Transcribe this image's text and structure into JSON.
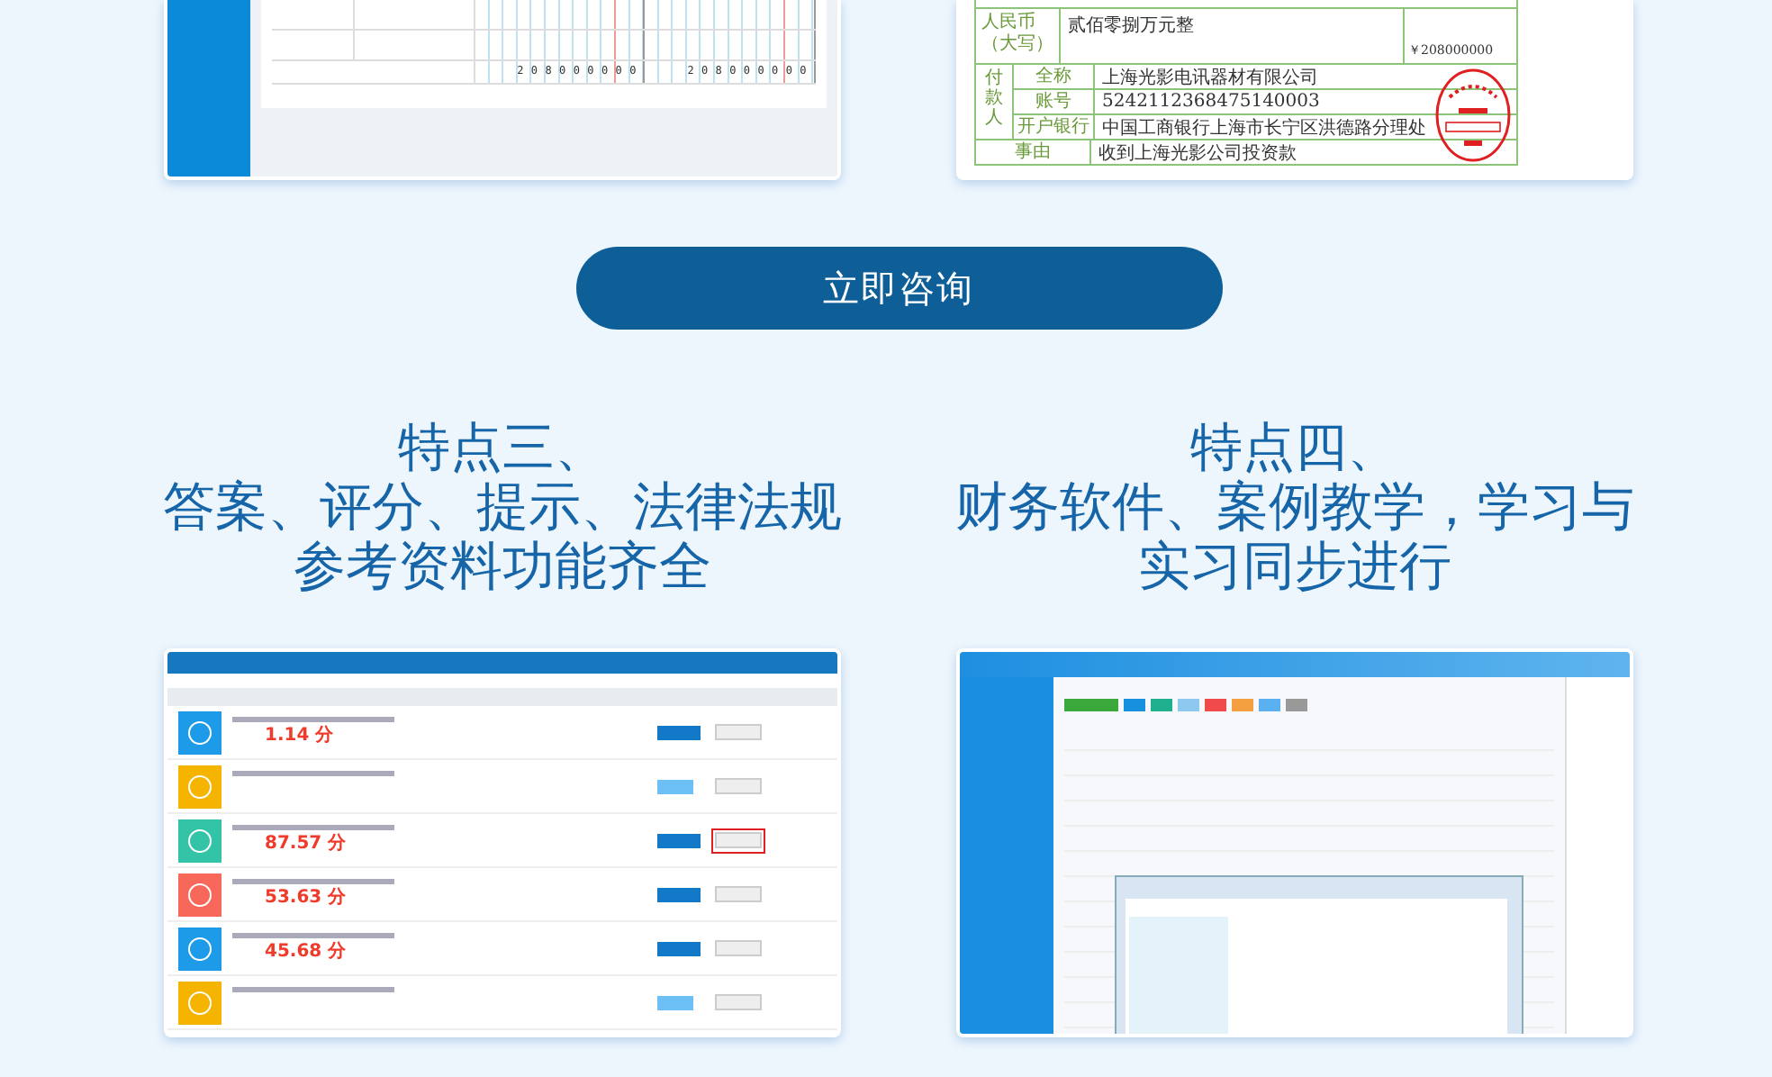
{
  "ledger_screenshot": {
    "debit_digits": "208000000",
    "credit_digits": "208000000"
  },
  "voucher_screenshot": {
    "amount_label": "人民币（大写）",
    "amount_words": "贰佰零捌万元整",
    "amount_figure": "￥208000000",
    "payer_label": "付款人",
    "payer_rows": [
      {
        "label": "全称",
        "value": "上海光影电讯器材有限公司"
      },
      {
        "label": "账号",
        "value": "5242112368475140003"
      },
      {
        "label": "开户银行",
        "value": "中国工商银行上海市长宁区洪德路分理处"
      }
    ],
    "reason_label": "事由",
    "reason_value": "收到上海光影公司投资款"
  },
  "consult_button": {
    "label": "立即咨询"
  },
  "features": [
    {
      "lines": [
        "特点三、",
        "答案、评分、提示、法律法规",
        "参考资料功能齐全"
      ]
    },
    {
      "lines": [
        "特点四、",
        "财务软件、案例教学，学习与",
        "实习同步进行"
      ]
    }
  ],
  "list_screenshot": {
    "rows": [
      {
        "color": "#1e9be8",
        "score": "1.14 分",
        "started": true,
        "highlighted": false
      },
      {
        "color": "#f5b400",
        "score": "",
        "started": false,
        "highlighted": false
      },
      {
        "color": "#33c4a8",
        "score": "87.57 分",
        "started": true,
        "highlighted": true
      },
      {
        "color": "#f7675a",
        "score": "53.63 分",
        "started": true,
        "highlighted": false
      },
      {
        "color": "#1e9be8",
        "score": "45.68 分",
        "started": true,
        "highlighted": false
      },
      {
        "color": "#f5b400",
        "score": "",
        "started": false,
        "highlighted": false
      }
    ]
  }
}
